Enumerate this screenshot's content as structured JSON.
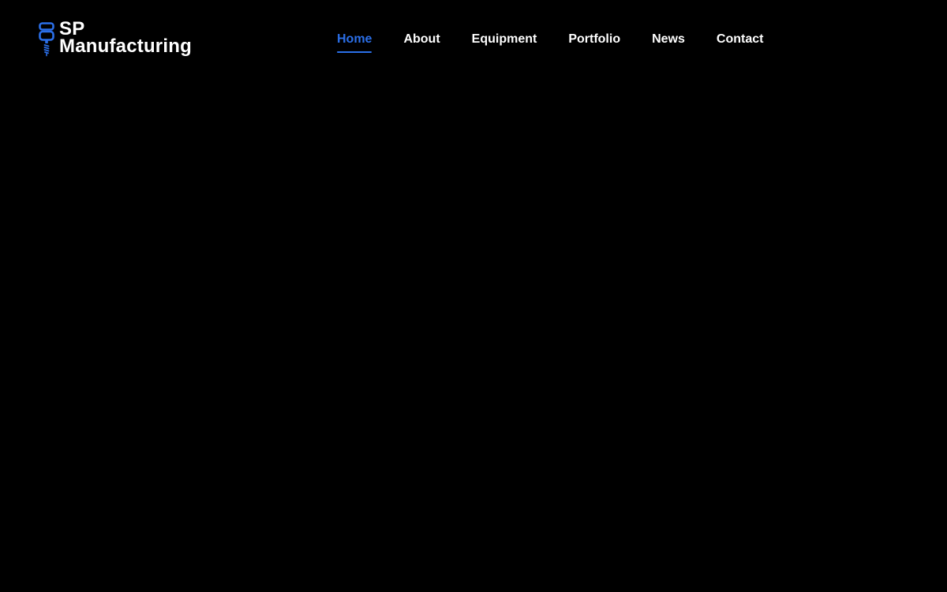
{
  "brand": {
    "line1": "SP",
    "line2": "Manufacturing",
    "icon": "cnc-spindle-icon"
  },
  "nav": {
    "items": [
      {
        "label": "Home",
        "active": true
      },
      {
        "label": "About",
        "active": false
      },
      {
        "label": "Equipment",
        "active": false
      },
      {
        "label": "Portfolio",
        "active": false
      },
      {
        "label": "News",
        "active": false
      },
      {
        "label": "Contact",
        "active": false
      }
    ]
  },
  "colors": {
    "background": "#000000",
    "accent": "#2b6fe8",
    "text": "#ffffff"
  }
}
